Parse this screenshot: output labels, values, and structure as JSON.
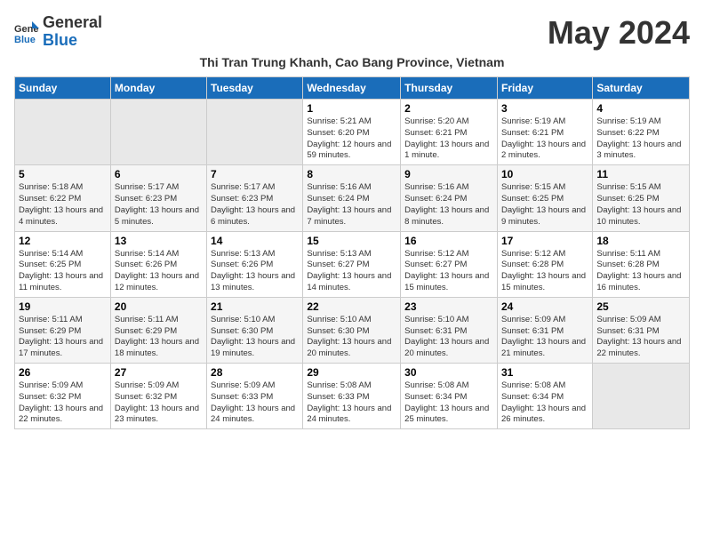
{
  "header": {
    "logo_line1": "General",
    "logo_line2": "Blue",
    "month_year": "May 2024",
    "subtitle": "Thi Tran Trung Khanh, Cao Bang Province, Vietnam"
  },
  "weekdays": [
    "Sunday",
    "Monday",
    "Tuesday",
    "Wednesday",
    "Thursday",
    "Friday",
    "Saturday"
  ],
  "weeks": [
    [
      {
        "day": "",
        "info": ""
      },
      {
        "day": "",
        "info": ""
      },
      {
        "day": "",
        "info": ""
      },
      {
        "day": "1",
        "info": "Sunrise: 5:21 AM\nSunset: 6:20 PM\nDaylight: 12 hours and 59 minutes."
      },
      {
        "day": "2",
        "info": "Sunrise: 5:20 AM\nSunset: 6:21 PM\nDaylight: 13 hours and 1 minute."
      },
      {
        "day": "3",
        "info": "Sunrise: 5:19 AM\nSunset: 6:21 PM\nDaylight: 13 hours and 2 minutes."
      },
      {
        "day": "4",
        "info": "Sunrise: 5:19 AM\nSunset: 6:22 PM\nDaylight: 13 hours and 3 minutes."
      }
    ],
    [
      {
        "day": "5",
        "info": "Sunrise: 5:18 AM\nSunset: 6:22 PM\nDaylight: 13 hours and 4 minutes."
      },
      {
        "day": "6",
        "info": "Sunrise: 5:17 AM\nSunset: 6:23 PM\nDaylight: 13 hours and 5 minutes."
      },
      {
        "day": "7",
        "info": "Sunrise: 5:17 AM\nSunset: 6:23 PM\nDaylight: 13 hours and 6 minutes."
      },
      {
        "day": "8",
        "info": "Sunrise: 5:16 AM\nSunset: 6:24 PM\nDaylight: 13 hours and 7 minutes."
      },
      {
        "day": "9",
        "info": "Sunrise: 5:16 AM\nSunset: 6:24 PM\nDaylight: 13 hours and 8 minutes."
      },
      {
        "day": "10",
        "info": "Sunrise: 5:15 AM\nSunset: 6:25 PM\nDaylight: 13 hours and 9 minutes."
      },
      {
        "day": "11",
        "info": "Sunrise: 5:15 AM\nSunset: 6:25 PM\nDaylight: 13 hours and 10 minutes."
      }
    ],
    [
      {
        "day": "12",
        "info": "Sunrise: 5:14 AM\nSunset: 6:25 PM\nDaylight: 13 hours and 11 minutes."
      },
      {
        "day": "13",
        "info": "Sunrise: 5:14 AM\nSunset: 6:26 PM\nDaylight: 13 hours and 12 minutes."
      },
      {
        "day": "14",
        "info": "Sunrise: 5:13 AM\nSunset: 6:26 PM\nDaylight: 13 hours and 13 minutes."
      },
      {
        "day": "15",
        "info": "Sunrise: 5:13 AM\nSunset: 6:27 PM\nDaylight: 13 hours and 14 minutes."
      },
      {
        "day": "16",
        "info": "Sunrise: 5:12 AM\nSunset: 6:27 PM\nDaylight: 13 hours and 15 minutes."
      },
      {
        "day": "17",
        "info": "Sunrise: 5:12 AM\nSunset: 6:28 PM\nDaylight: 13 hours and 15 minutes."
      },
      {
        "day": "18",
        "info": "Sunrise: 5:11 AM\nSunset: 6:28 PM\nDaylight: 13 hours and 16 minutes."
      }
    ],
    [
      {
        "day": "19",
        "info": "Sunrise: 5:11 AM\nSunset: 6:29 PM\nDaylight: 13 hours and 17 minutes."
      },
      {
        "day": "20",
        "info": "Sunrise: 5:11 AM\nSunset: 6:29 PM\nDaylight: 13 hours and 18 minutes."
      },
      {
        "day": "21",
        "info": "Sunrise: 5:10 AM\nSunset: 6:30 PM\nDaylight: 13 hours and 19 minutes."
      },
      {
        "day": "22",
        "info": "Sunrise: 5:10 AM\nSunset: 6:30 PM\nDaylight: 13 hours and 20 minutes."
      },
      {
        "day": "23",
        "info": "Sunrise: 5:10 AM\nSunset: 6:31 PM\nDaylight: 13 hours and 20 minutes."
      },
      {
        "day": "24",
        "info": "Sunrise: 5:09 AM\nSunset: 6:31 PM\nDaylight: 13 hours and 21 minutes."
      },
      {
        "day": "25",
        "info": "Sunrise: 5:09 AM\nSunset: 6:31 PM\nDaylight: 13 hours and 22 minutes."
      }
    ],
    [
      {
        "day": "26",
        "info": "Sunrise: 5:09 AM\nSunset: 6:32 PM\nDaylight: 13 hours and 22 minutes."
      },
      {
        "day": "27",
        "info": "Sunrise: 5:09 AM\nSunset: 6:32 PM\nDaylight: 13 hours and 23 minutes."
      },
      {
        "day": "28",
        "info": "Sunrise: 5:09 AM\nSunset: 6:33 PM\nDaylight: 13 hours and 24 minutes."
      },
      {
        "day": "29",
        "info": "Sunrise: 5:08 AM\nSunset: 6:33 PM\nDaylight: 13 hours and 24 minutes."
      },
      {
        "day": "30",
        "info": "Sunrise: 5:08 AM\nSunset: 6:34 PM\nDaylight: 13 hours and 25 minutes."
      },
      {
        "day": "31",
        "info": "Sunrise: 5:08 AM\nSunset: 6:34 PM\nDaylight: 13 hours and 26 minutes."
      },
      {
        "day": "",
        "info": ""
      }
    ]
  ]
}
